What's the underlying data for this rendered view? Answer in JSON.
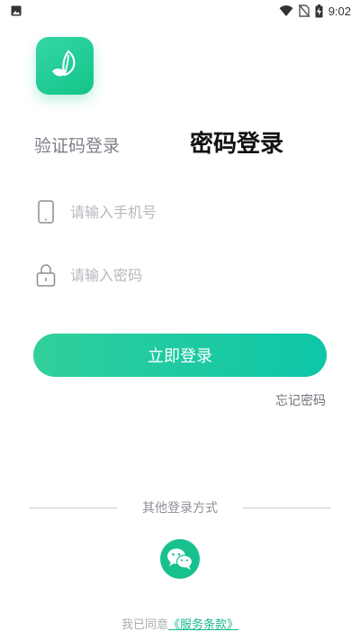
{
  "status_bar": {
    "time": "9:02",
    "icons": [
      "image-icon",
      "wifi-icon",
      "no-sim-icon",
      "battery-charging-icon"
    ]
  },
  "app": {
    "logo_icon": "leaf-logo-icon",
    "brand_color": "#18c48b"
  },
  "tabs": {
    "sms_login": "验证码登录",
    "password_login": "密码登录",
    "active": "password_login"
  },
  "form": {
    "phone": {
      "placeholder": "请输入手机号",
      "value": "",
      "icon": "phone-icon"
    },
    "password": {
      "placeholder": "请输入密码",
      "value": "",
      "icon": "lock-icon"
    }
  },
  "login_button": {
    "label": "立即登录"
  },
  "forgot_password": {
    "label": "忘记密码"
  },
  "other_login": {
    "label": "其他登录方式",
    "wechat_icon": "wechat-icon"
  },
  "agreement": {
    "prefix": "我已同意",
    "link": "《服务条款》"
  }
}
